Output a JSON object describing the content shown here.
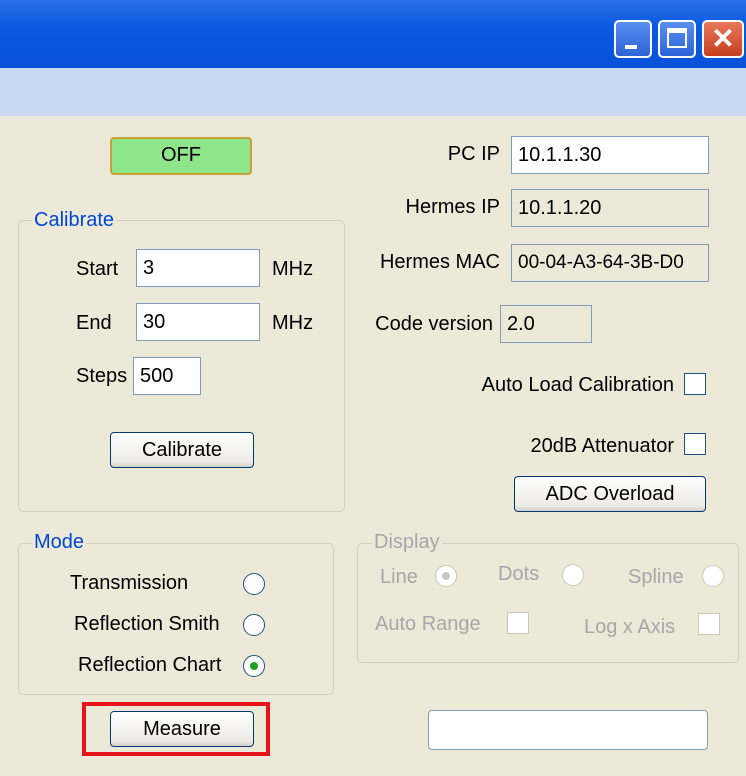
{
  "window": {
    "title": "",
    "controls": {
      "minimize": "minimize-icon",
      "maximize": "maximize-icon",
      "close": "close-icon"
    }
  },
  "power": {
    "label": "OFF",
    "color": "#8ee58a"
  },
  "network": {
    "pc_ip_label": "PC IP",
    "pc_ip_value": "10.1.1.30",
    "hermes_ip_label": "Hermes IP",
    "hermes_ip_value": "10.1.1.20",
    "hermes_mac_label": "Hermes MAC",
    "hermes_mac_value": "00-04-A3-64-3B-D0",
    "code_version_label": "Code version",
    "code_version_value": "2.0"
  },
  "calibrate": {
    "title": "Calibrate",
    "start_label": "Start",
    "start_value": "3",
    "start_unit": "MHz",
    "end_label": "End",
    "end_value": "30",
    "end_unit": "MHz",
    "steps_label": "Steps",
    "steps_value": "500",
    "button_label": "Calibrate"
  },
  "options": {
    "auto_load_label": "Auto Load Calibration",
    "auto_load_checked": false,
    "attenuator_label": "20dB Attenuator",
    "attenuator_checked": false,
    "adc_button_label": "ADC Overload"
  },
  "mode": {
    "title": "Mode",
    "options": [
      {
        "label": "Transmission",
        "selected": false
      },
      {
        "label": "Reflection Smith",
        "selected": false
      },
      {
        "label": "Reflection Chart",
        "selected": true
      }
    ]
  },
  "display": {
    "title": "Display",
    "line_label": "Line",
    "dots_label": "Dots",
    "spline_label": "Spline",
    "selected": "Line",
    "auto_range_label": "Auto Range",
    "log_x_label": "Log x Axis"
  },
  "measure": {
    "button_label": "Measure",
    "highlight_color": "#e8141c"
  },
  "status": {
    "value": ""
  },
  "colors": {
    "titlebar": "#0a5ae0",
    "menustrip": "#c7d9f3",
    "panel": "#ece9d8",
    "group_title": "#0046d5",
    "disabled_text": "#a7a6aa"
  }
}
